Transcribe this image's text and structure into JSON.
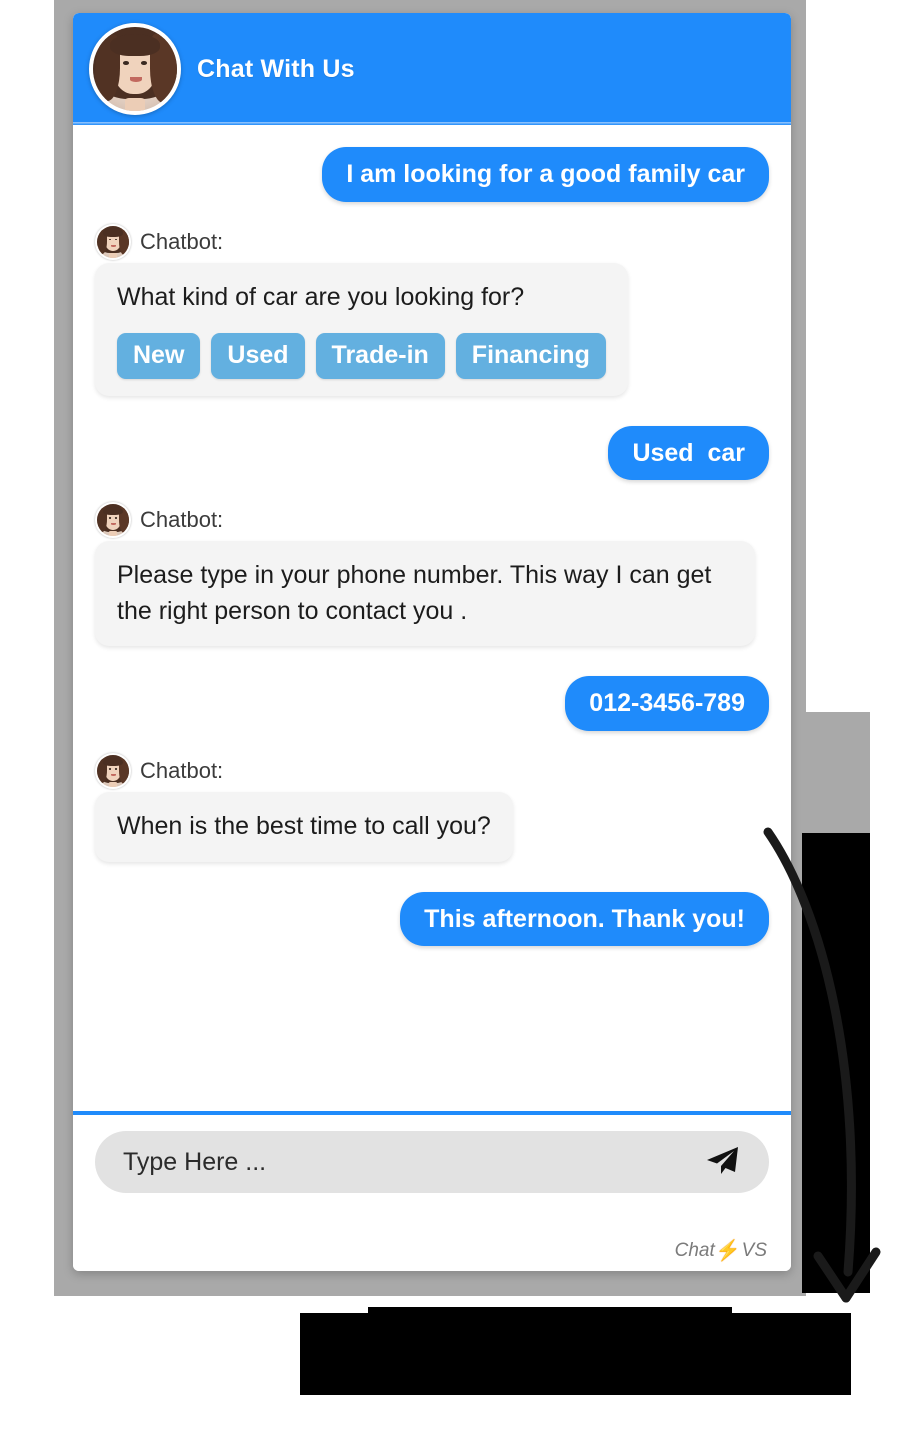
{
  "header": {
    "title": "Chat With Us",
    "avatar_name": "agent-photo"
  },
  "conversation": [
    {
      "sender": "user",
      "text": "I am looking for a good family car"
    },
    {
      "sender": "bot",
      "name": "Chatbot:",
      "text": "What kind of car are you looking for?",
      "chips": [
        "New",
        "Used",
        "Trade-in",
        "Financing"
      ]
    },
    {
      "sender": "user",
      "text": "Used  car"
    },
    {
      "sender": "bot",
      "name": "Chatbot:",
      "text": "Please type in your phone number. This way I can get the right person to contact you ."
    },
    {
      "sender": "user",
      "text": "012-3456-789"
    },
    {
      "sender": "bot",
      "name": "Chatbot:",
      "text": "When is the best time to call you?"
    },
    {
      "sender": "user",
      "text": "This afternoon. Thank you!"
    }
  ],
  "composer": {
    "placeholder": "Type Here ...",
    "value": "",
    "send_icon": "send-paper-plane-icon"
  },
  "brand": {
    "text_left": "Chat",
    "bolt": "⚡",
    "text_right": "VS"
  },
  "colors": {
    "accent_blue": "#1f8bfb",
    "chip_blue": "#63b0e0",
    "bot_bubble": "#f4f4f4",
    "frame_gray": "#a9a9a9",
    "input_gray": "#e2e2e2",
    "bolt_orange": "#f5a623"
  }
}
